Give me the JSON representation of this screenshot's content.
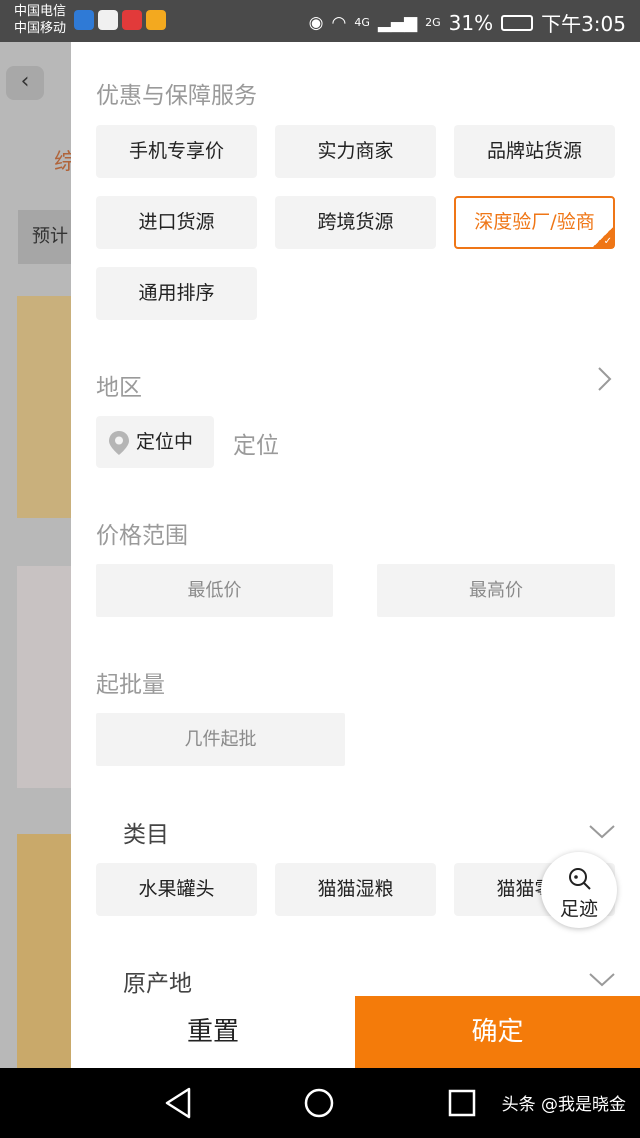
{
  "status_bar": {
    "carrier1": "中国电信",
    "carrier2": "中国移动",
    "net_4g": "4G",
    "net_2g": "2G",
    "battery": "31%",
    "time": "下午3:05"
  },
  "background_page": {
    "tab": "综",
    "chip": "预计"
  },
  "filter": {
    "service_title": "优惠与保障服务",
    "service_chips": [
      {
        "label": "手机专享价",
        "selected": false
      },
      {
        "label": "实力商家",
        "selected": false
      },
      {
        "label": "品牌站货源",
        "selected": false
      },
      {
        "label": "进口货源",
        "selected": false
      },
      {
        "label": "跨境货源",
        "selected": false
      },
      {
        "label": "深度验厂/验商",
        "selected": true
      },
      {
        "label": "通用排序",
        "selected": false
      }
    ],
    "region_title": "地区",
    "locate_button": "定位中",
    "locate_text": "定位",
    "price_title": "价格范围",
    "price_min_placeholder": "最低价",
    "price_max_placeholder": "最高价",
    "moq_title": "起批量",
    "moq_placeholder": "几件起批",
    "category_title": "类目",
    "category_chips": [
      "水果罐头",
      "猫猫湿粮",
      "猫猫零食"
    ],
    "origin_title": "原产地",
    "footprint_label": "足迹",
    "reset_label": "重置",
    "confirm_label": "确定"
  },
  "watermark": "头条 @我是晓金",
  "colors": {
    "accent": "#f47b0a",
    "selected_border": "#ef7616"
  }
}
